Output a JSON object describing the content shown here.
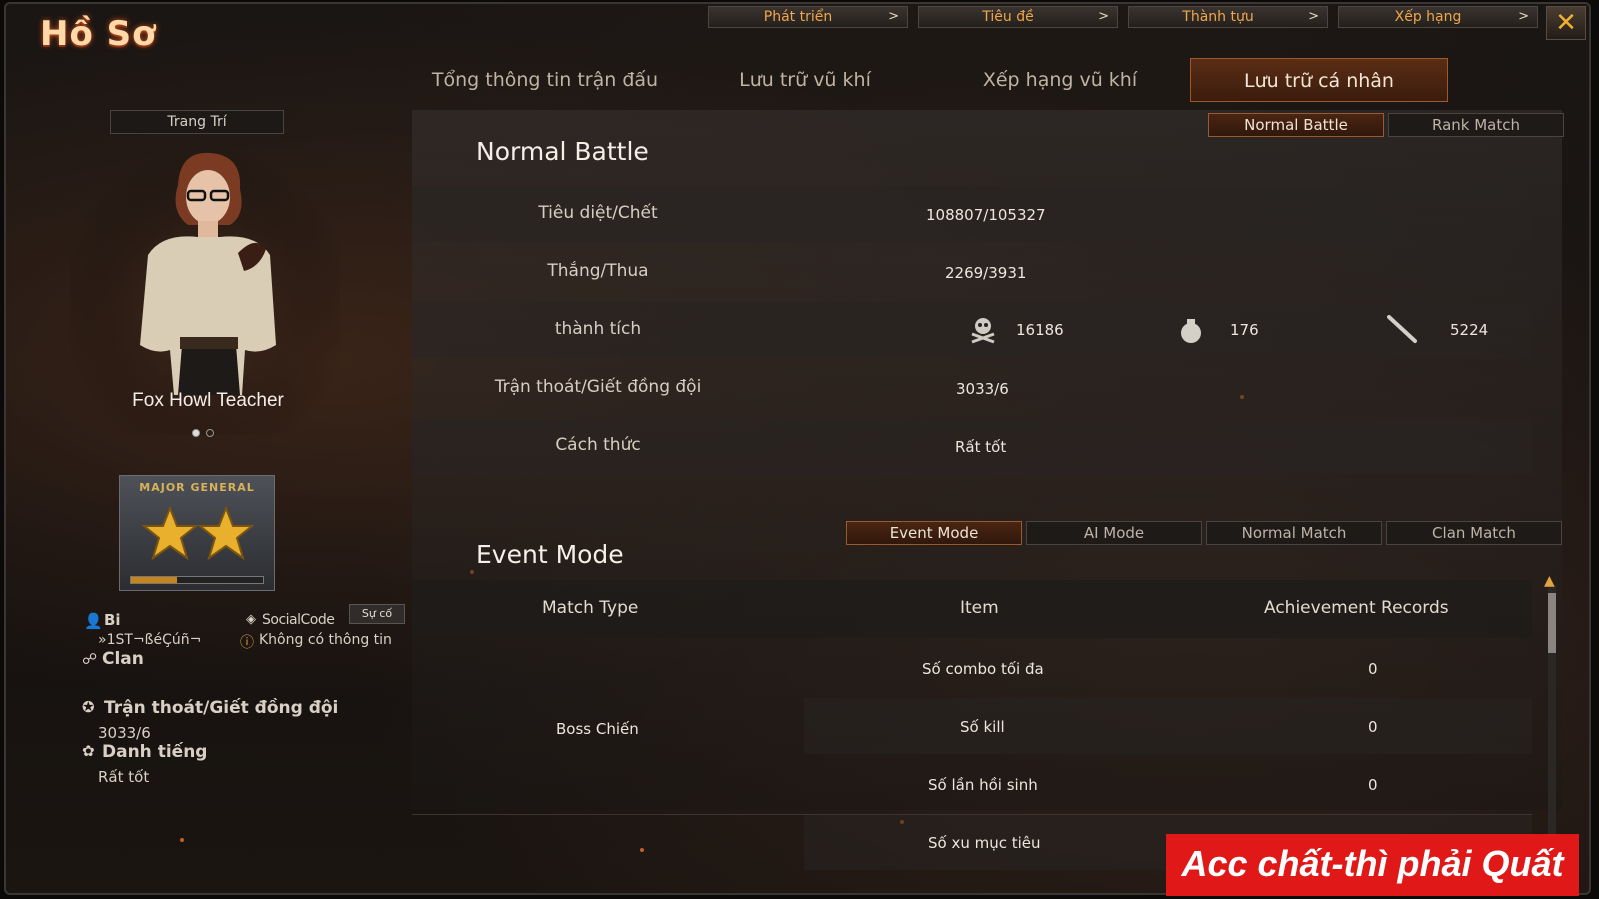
{
  "header": {
    "title": "Hồ Sơ"
  },
  "top_nav": [
    {
      "label": "Phát triển",
      "arrow": ">"
    },
    {
      "label": "Tiêu đề",
      "arrow": ">"
    },
    {
      "label": "Thành tựu",
      "arrow": ">"
    },
    {
      "label": "Xếp hạng",
      "arrow": ">"
    }
  ],
  "close_label": "✕",
  "main_tabs": [
    {
      "label": "Tổng thông tin trận đấu",
      "active": false
    },
    {
      "label": "Lưu trữ vũ khí",
      "active": false
    },
    {
      "label": "Xếp hạng vũ khí",
      "active": false
    },
    {
      "label": "Lưu trữ cá nhân",
      "active": true
    }
  ],
  "left": {
    "decorate_label": "Trang Trí",
    "character_name": "Fox Howl Teacher",
    "rank_badge": "MAJOR GENERAL",
    "rank_progress": 0.35,
    "player_label": "Bi",
    "social_label": "SocialCode",
    "incident_button": "Sự cố",
    "player_name": "»1ST¬ßéÇúñ¬",
    "no_info": "Không có thông tin",
    "clan_label": "Clan",
    "escape_label": "Trận thoát/Giết đồng đội",
    "escape_value": "3033/6",
    "reputation_label": "Danh tiếng",
    "reputation_value": "Rất tốt"
  },
  "normal_battle": {
    "title": "Normal Battle",
    "tabs": [
      {
        "label": "Normal Battle",
        "active": true
      },
      {
        "label": "Rank Match",
        "active": false
      }
    ],
    "rows": [
      {
        "label": "Tiêu diệt/Chết",
        "value": "108807/105327"
      },
      {
        "label": "Thắng/Thua",
        "value": "2269/3931"
      },
      {
        "label": "thành tích",
        "value": ""
      },
      {
        "label": "Trận thoát/Giết đồng đội",
        "value": "3033/6"
      },
      {
        "label": "Cách thức",
        "value": "Rất tốt"
      }
    ],
    "achievements": [
      {
        "icon": "skull-icon",
        "value": "16186"
      },
      {
        "icon": "grenade-icon",
        "value": "176"
      },
      {
        "icon": "knife-icon",
        "value": "5224"
      }
    ]
  },
  "event_mode": {
    "title": "Event Mode",
    "tabs": [
      {
        "label": "Event Mode",
        "active": true
      },
      {
        "label": "AI Mode",
        "active": false
      },
      {
        "label": "Normal Match",
        "active": false
      },
      {
        "label": "Clan Match",
        "active": false
      }
    ],
    "columns": [
      "Match Type",
      "Item",
      "Achievement Records"
    ],
    "match_type": "Boss Chiến",
    "rows": [
      {
        "item": "Số combo tối đa",
        "record": "0"
      },
      {
        "item": "Số kill",
        "record": "0"
      },
      {
        "item": "Số lần hồi sinh",
        "record": "0"
      },
      {
        "item": "Số xu mục tiêu",
        "record": ""
      }
    ]
  },
  "banner": "Acc chất-thì phải Quất",
  "colors": {
    "accent": "#f0a64a",
    "active_tab": "#5a2d14",
    "banner": "#e01818"
  }
}
